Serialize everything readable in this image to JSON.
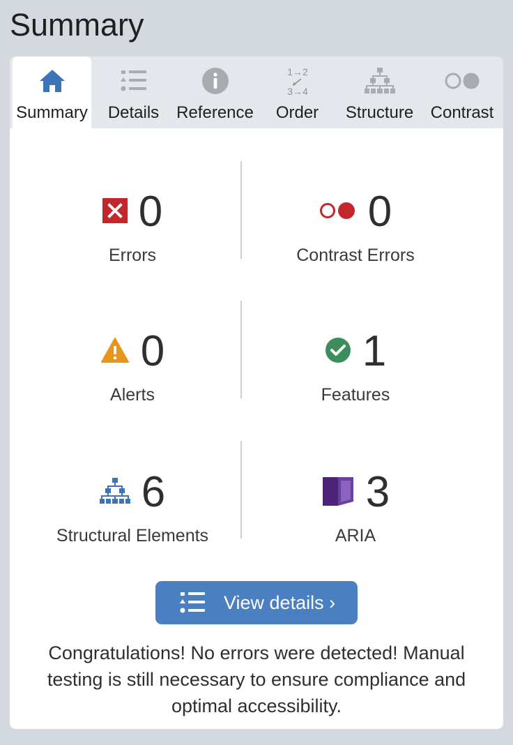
{
  "page_title": "Summary",
  "tabs": [
    {
      "label": "Summary",
      "icon": "home-icon",
      "active": true
    },
    {
      "label": "Details",
      "icon": "list-icon",
      "active": false
    },
    {
      "label": "Reference",
      "icon": "info-icon",
      "active": false
    },
    {
      "label": "Order",
      "icon": "order-icon",
      "active": false,
      "icon_text": [
        "1→2",
        "3→4"
      ]
    },
    {
      "label": "Structure",
      "icon": "structure-icon",
      "active": false
    },
    {
      "label": "Contrast",
      "icon": "contrast-icon",
      "active": false
    }
  ],
  "stats": {
    "errors": {
      "value": "0",
      "label": "Errors",
      "icon": "error-icon",
      "color": "#c1272d"
    },
    "contrast_errors": {
      "value": "0",
      "label": "Contrast Errors",
      "icon": "contrast-error-icon",
      "color": "#c1272d"
    },
    "alerts": {
      "value": "0",
      "label": "Alerts",
      "icon": "alert-icon",
      "color": "#e8951c"
    },
    "features": {
      "value": "1",
      "label": "Features",
      "icon": "feature-icon",
      "color": "#3d8c5b"
    },
    "structural": {
      "value": "6",
      "label": "Structural Elements",
      "icon": "structure-icon",
      "color": "#3b74b8"
    },
    "aria": {
      "value": "3",
      "label": "ARIA",
      "icon": "aria-icon",
      "color": "#5b2d8a"
    }
  },
  "view_details": {
    "label": "View details ›",
    "icon": "list-icon"
  },
  "message": "Congratulations! No errors were detected! Manual testing is still necessary to ensure compliance and optimal accessibility.",
  "colors": {
    "accent": "#4a7fc1",
    "tab_icon": "#a8abb0",
    "active_tab_icon": "#3b74b8",
    "background": "#d4d9e0"
  }
}
